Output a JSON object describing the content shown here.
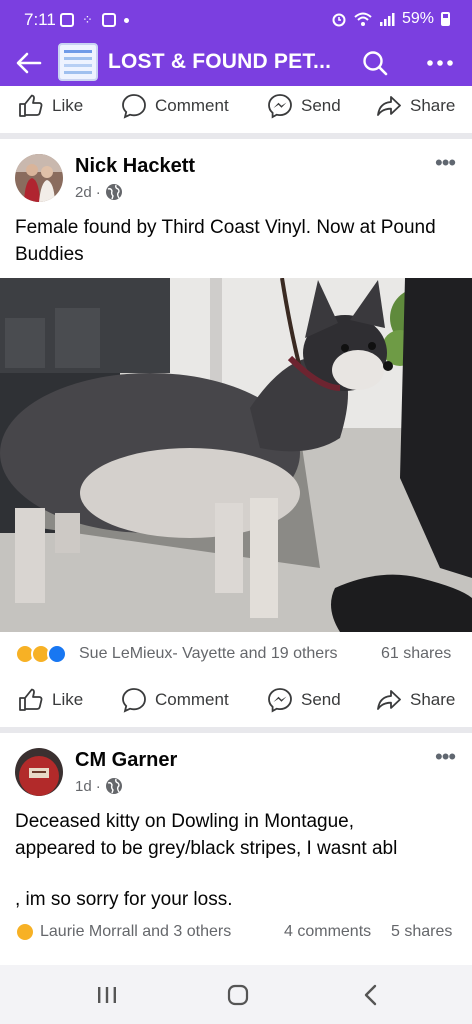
{
  "status_bar": {
    "time": "7:11",
    "battery": "59%"
  },
  "header": {
    "title": "LOST & FOUND PET..."
  },
  "top_actions": {
    "like": "Like",
    "comment": "Comment",
    "send": "Send",
    "share": "Share"
  },
  "post1": {
    "author": "Nick Hackett",
    "time": "2d",
    "text": "Female found by Third Coast Vinyl. Now at Pound Buddies",
    "reactions_text": "Sue LeMieux- Vayette and 19 others",
    "shares": "61 shares",
    "actions": {
      "like": "Like",
      "comment": "Comment",
      "send": "Send",
      "share": "Share"
    }
  },
  "post2": {
    "author": "CM Garner",
    "time": "1d",
    "text_line1": "Deceased kitty on Dowling in Montague,",
    "text_line2": "appeared to be grey/black stripes, I wasnt abl",
    "text_line3": ", im so sorry for your loss.",
    "reactions_text": "Laurie Morrall and 3 others",
    "comments": "4 comments",
    "shares": "5 shares"
  },
  "colors": {
    "header": "#7b3fe0",
    "text": "#050505",
    "muted": "#65676b",
    "like_blue": "#1877f2"
  },
  "icons": [
    "back-arrow-icon",
    "search-icon",
    "more-icon",
    "like-icon",
    "comment-icon",
    "send-icon",
    "share-icon",
    "globe-icon",
    "menu-icon",
    "home-icon",
    "back-icon"
  ]
}
